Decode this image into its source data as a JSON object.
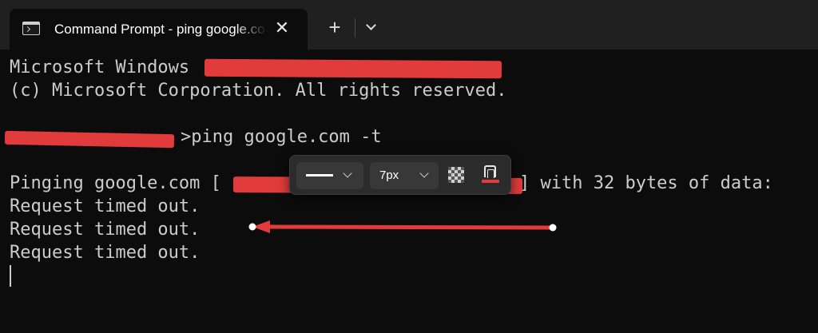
{
  "tab": {
    "title": "Command Prompt - ping google.com -t",
    "close_glyph": "✕",
    "icon": "terminal-icon"
  },
  "titlebar": {
    "new_tab_glyph": "+",
    "dropdown_icon": "chevron-down-icon"
  },
  "terminal": {
    "line1": "Microsoft Windows",
    "line2": "(c) Microsoft Corporation. All rights reserved.",
    "line3_command": ">ping google.com -t",
    "line4_prefix": "Pinging google.com [",
    "line4_suffix": "] with 32 bytes of data:",
    "responses": [
      "Request timed out.",
      "Request timed out.",
      "Request timed out."
    ]
  },
  "annotation_toolbar": {
    "line_style_icon": "solid-line-icon",
    "stroke_size": "7px",
    "opacity_icon": "checkerboard-opacity-icon",
    "color_icon": "highlighter-color-icon",
    "color": "#e23b3b"
  },
  "colors": {
    "terminal_bg": "#0c0c0c",
    "titlebar_bg": "#202020",
    "text": "#cccccc",
    "annotation": "#e23b3b"
  }
}
